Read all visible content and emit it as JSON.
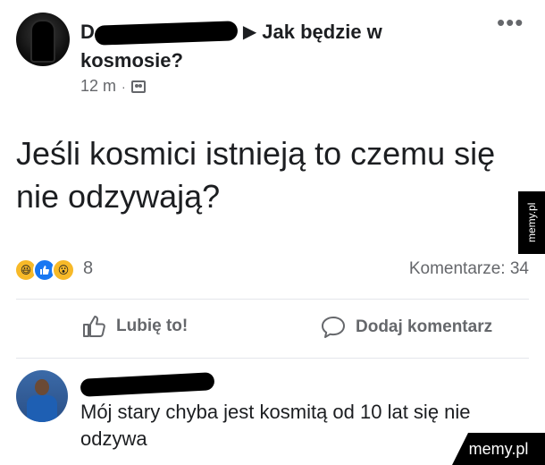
{
  "post": {
    "author_initial": "D",
    "group_name_line1": "Jak będzie w",
    "group_name_line2": "kosmosie?",
    "time": "12 m",
    "meta_separator": "·",
    "text": "Jeśli kosmici istnieją to czemu się nie odzywają?"
  },
  "reactions": {
    "count": "8",
    "icons": [
      "haha-icon",
      "like-icon",
      "wow-icon"
    ],
    "comments_label": "Komentarze: 34"
  },
  "actions": {
    "like_label": "Lubię to!",
    "comment_label": "Dodaj komentarz"
  },
  "comment": {
    "text": "Mój stary chyba jest kosmitą od 10 lat się nie odzywa"
  },
  "watermark": {
    "side": "memy.pl",
    "corner": "memy.pl"
  },
  "colors": {
    "text_primary": "#1c1e21",
    "text_secondary": "#65676b",
    "like_blue": "#1877f2",
    "reaction_yellow": "#f7b928"
  }
}
